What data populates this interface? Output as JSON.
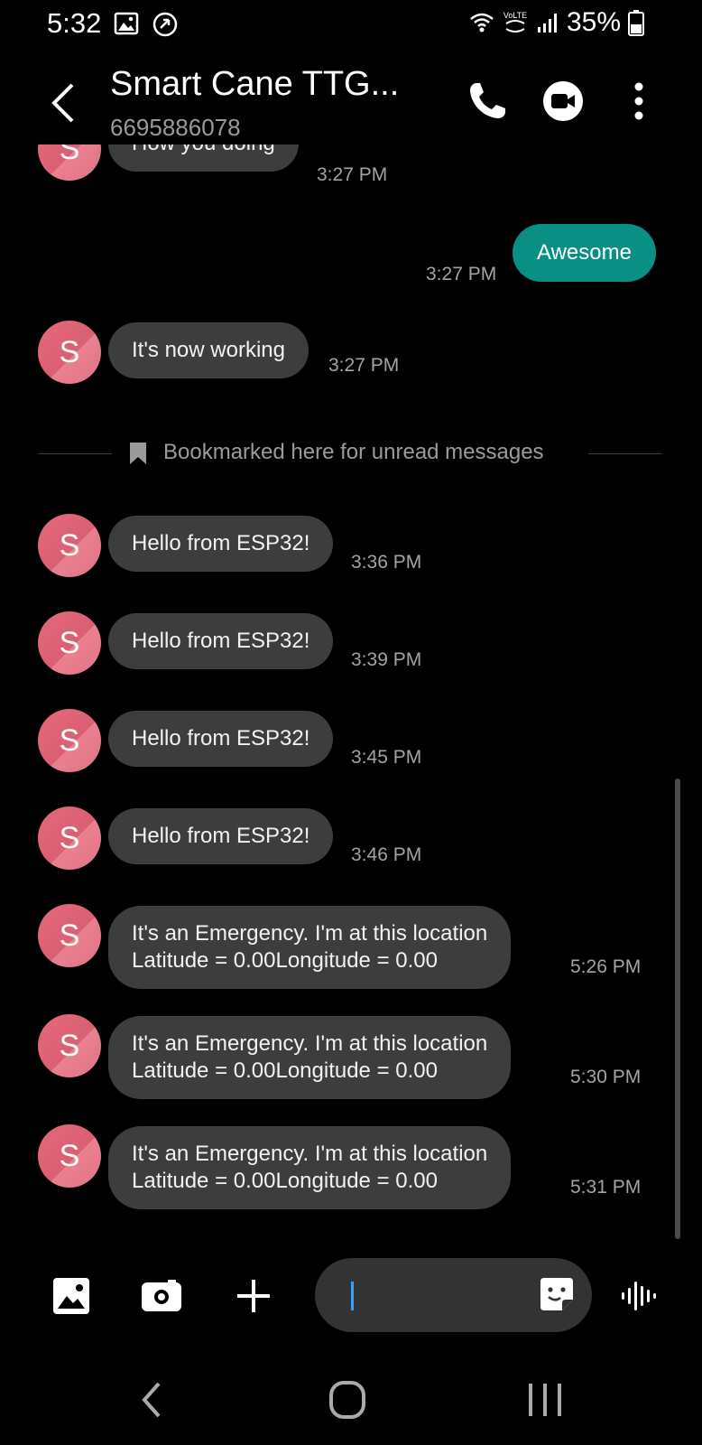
{
  "status_bar": {
    "time": "5:32",
    "battery_text": "35%",
    "icons": [
      "gallery-notification-icon",
      "sync-notification-icon",
      "wifi-icon",
      "volte-icon",
      "signal-icon",
      "battery-icon"
    ],
    "volte_label": "VoLTE"
  },
  "header": {
    "title": "Smart Cane TTG...",
    "subtitle": "6695886078",
    "actions": [
      "back-icon",
      "phone-icon",
      "video-call-icon",
      "more-options-icon"
    ]
  },
  "avatar_letter": "S",
  "messages": [
    {
      "direction": "incoming",
      "text": "How you doing",
      "time": "3:27 PM"
    },
    {
      "direction": "outgoing",
      "text": "Awesome",
      "time": "3:27 PM"
    },
    {
      "direction": "incoming",
      "text": "It's now working",
      "time": "3:27 PM"
    },
    {
      "direction": "incoming",
      "text": "Hello from ESP32!",
      "time": "3:36 PM"
    },
    {
      "direction": "incoming",
      "text": "Hello from ESP32!",
      "time": "3:39 PM"
    },
    {
      "direction": "incoming",
      "text": "Hello from ESP32!",
      "time": "3:45 PM"
    },
    {
      "direction": "incoming",
      "text": "Hello from ESP32!",
      "time": "3:46 PM"
    },
    {
      "direction": "incoming",
      "text_line1": "It's an Emergency. I'm at this location",
      "text_line2": "Latitude = 0.00Longitude = 0.00",
      "time": "5:26 PM"
    },
    {
      "direction": "incoming",
      "text_line1": "It's an Emergency. I'm at this location",
      "text_line2": "Latitude = 0.00Longitude = 0.00",
      "time": "5:30 PM"
    },
    {
      "direction": "incoming",
      "text_line1": "It's an Emergency. I'm at this location",
      "text_line2": "Latitude = 0.00Longitude = 0.00",
      "time": "5:31 PM"
    }
  ],
  "bookmark_label": "Bookmarked here for unread messages",
  "composer": {
    "icons": [
      "gallery-icon",
      "camera-icon",
      "add-icon",
      "sticker-icon",
      "voice-record-icon"
    ],
    "input_value": ""
  },
  "nav": {
    "icons": [
      "nav-back-icon",
      "nav-home-icon",
      "nav-recents-icon"
    ]
  },
  "colors": {
    "background": "#000000",
    "incoming_bubble": "#3d3d3d",
    "outgoing_bubble": "#0a8f84",
    "avatar": "#e46a7d",
    "timestamp": "#a3a3a3"
  }
}
